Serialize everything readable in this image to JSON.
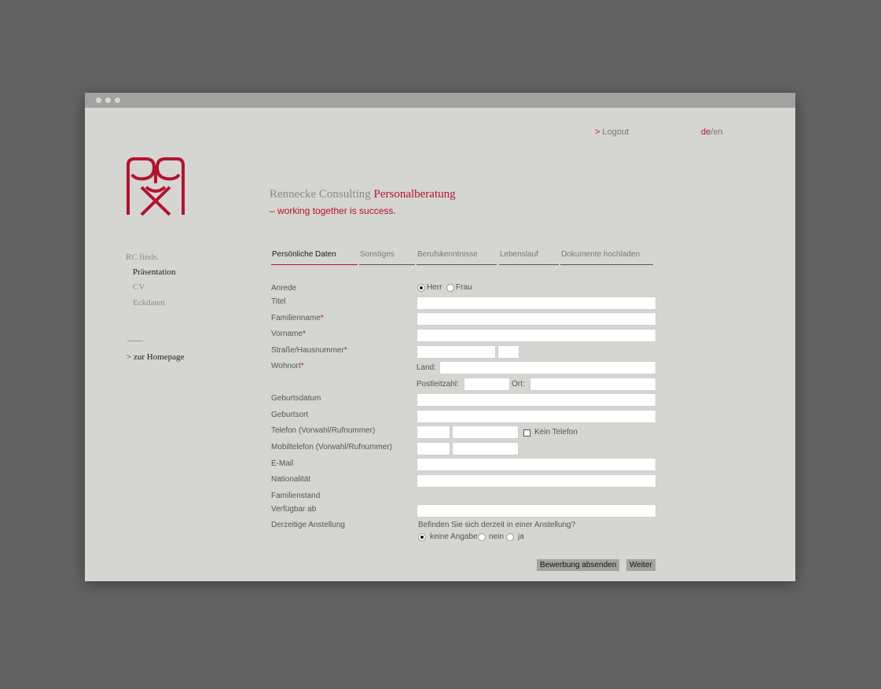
{
  "topnav": {
    "logout_arrow": ">",
    "logout": "Logout",
    "lang_de": "de",
    "lang_sep": "/",
    "lang_en": "en"
  },
  "brand": {
    "name_grey": "Rennecke Consulting",
    "name_red": "Personalberatung",
    "tagline": "– working together is success."
  },
  "sidebar": {
    "heading": "RC finds.",
    "items": [
      {
        "label": "Präsentation",
        "active": true
      },
      {
        "label": "CV",
        "active": false
      },
      {
        "label": "Eckdaten",
        "active": false
      }
    ],
    "homepage_arrow": ">",
    "homepage": "zur Homepage"
  },
  "tabs": [
    {
      "label": "Persönliche Daten",
      "active": true
    },
    {
      "label": "Sonstiges",
      "active": false
    },
    {
      "label": "Berufskenntnisse",
      "active": false
    },
    {
      "label": "Lebenslauf",
      "active": false
    },
    {
      "label": "Dokumente hochladen",
      "active": false
    }
  ],
  "form": {
    "required_mark": "*",
    "anrede": {
      "label": "Anrede",
      "options": [
        "Herr",
        "Frau"
      ],
      "selected": "Herr"
    },
    "titel": {
      "label": "Titel",
      "value": ""
    },
    "familienname": {
      "label": "Familienname",
      "value": ""
    },
    "vorname": {
      "label": "Vorname",
      "value": ""
    },
    "strasse": {
      "label": "Straße/Hausnummer",
      "street": "",
      "number": ""
    },
    "wohnort": {
      "label": "Wohnort",
      "land_label": "Land:",
      "land": "",
      "plz_label": "Postleitzahl:",
      "plz": "",
      "ort_label": "Ort:",
      "ort": ""
    },
    "geburtsdatum": {
      "label": "Geburtsdatum",
      "value": ""
    },
    "geburtsort": {
      "label": "Geburtsort",
      "value": ""
    },
    "telefon": {
      "label": "Telefon (Vorwahl/Rufnummer)",
      "vorwahl": "",
      "nummer": "",
      "kein_telefon_label": "Kein Telefon",
      "kein_telefon": false
    },
    "mobil": {
      "label": "Mobiltelefon (Vorwahl/Rufnummer)",
      "vorwahl": "",
      "nummer": ""
    },
    "email": {
      "label": "E-Mail",
      "value": ""
    },
    "nationalitaet": {
      "label": "Nationalität",
      "value": ""
    },
    "familienstand": {
      "label": "Familienstand"
    },
    "verfuegbar": {
      "label": "Verfügbar ab",
      "value": ""
    },
    "anstellung": {
      "label": "Derzeitige Anstellung",
      "question": "Befinden Sie sich derzeit in einer Anstellung?",
      "options": [
        "keine Angabe",
        "nein",
        "ja"
      ],
      "selected": "keine Angabe"
    }
  },
  "buttons": {
    "submit": "Bewerbung absenden",
    "next": "Weiter"
  },
  "colors": {
    "accent": "#b4122e",
    "window_bg": "#d5d5d1",
    "desktop_bg": "#626262"
  }
}
